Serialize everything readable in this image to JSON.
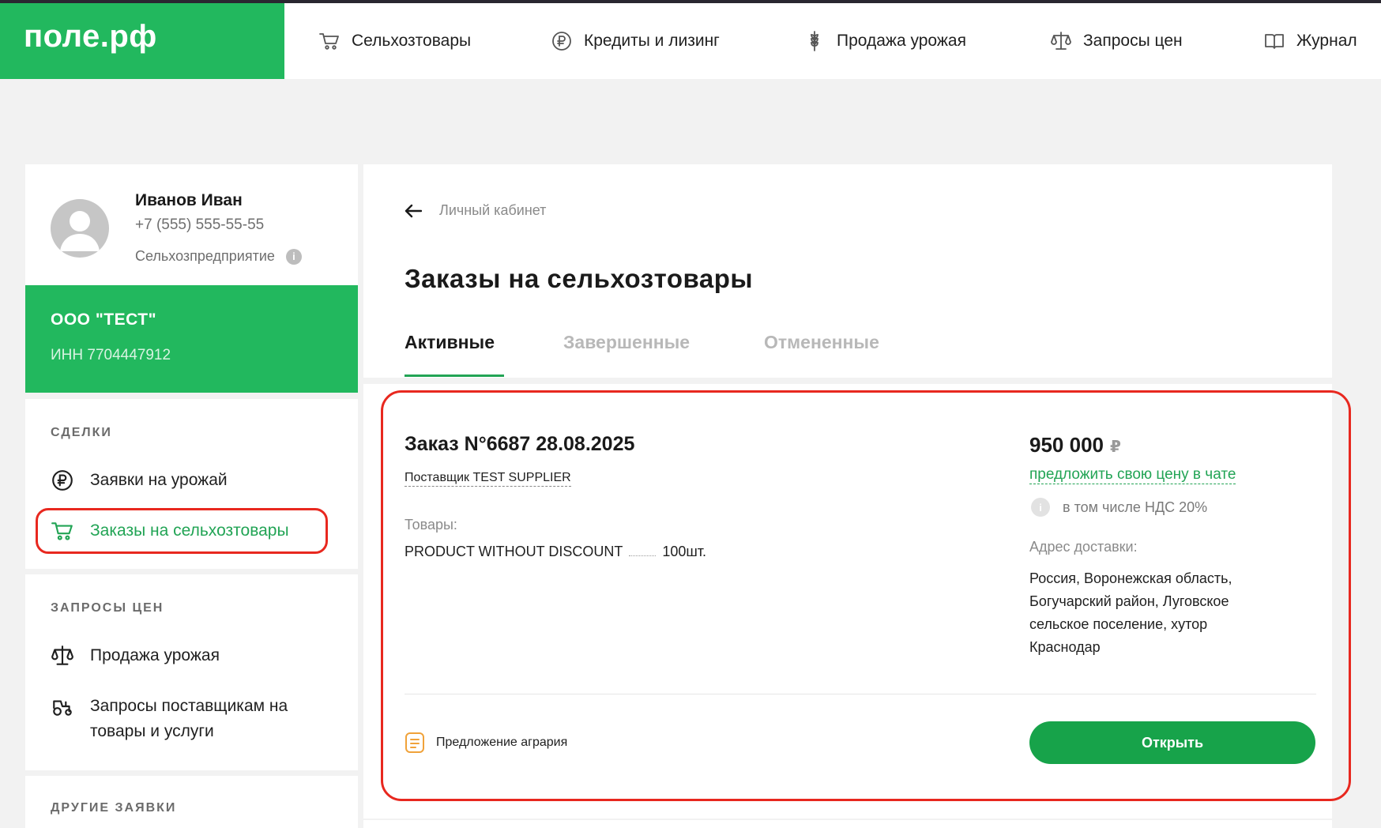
{
  "header": {
    "logo": "поле.рф",
    "nav": [
      {
        "label": "Сельхозтовары",
        "icon": "cart-icon"
      },
      {
        "label": "Кредиты и лизинг",
        "icon": "ruble-coin-icon"
      },
      {
        "label": "Продажа урожая",
        "icon": "wheat-icon"
      },
      {
        "label": "Запросы цен",
        "icon": "scales-icon"
      },
      {
        "label": "Журнал",
        "icon": "book-icon"
      }
    ]
  },
  "profile": {
    "name": "Иванов Иван",
    "phone": "+7 (555) 555-55-55",
    "type": "Сельхозпредприятие",
    "company": "ООО \"ТЕСТ\"",
    "inn": "ИНН 7704447912"
  },
  "sidebar": {
    "deals": {
      "label": "СДЕЛКИ",
      "items": [
        {
          "label": "Заявки на урожай",
          "icon": "ruble-coin-icon"
        },
        {
          "label": "Заказы на сельхозтовары",
          "icon": "cart-icon",
          "active": true
        }
      ]
    },
    "price_requests": {
      "label": "ЗАПРОСЫ ЦЕН",
      "items": [
        {
          "label": "Продажа урожая",
          "icon": "scales-icon"
        },
        {
          "label": "Запросы поставщикам на товары и услуги",
          "icon": "tractor-icon"
        }
      ]
    },
    "other": {
      "label": "ДРУГИЕ ЗАЯВКИ"
    }
  },
  "main": {
    "back": "Личный кабинет",
    "title": "Заказы на сельхозтовары",
    "tabs": [
      {
        "label": "Активные",
        "active": true
      },
      {
        "label": "Завершенные"
      },
      {
        "label": "Отмененные"
      }
    ]
  },
  "order": {
    "title": "Заказ N°6687 28.08.2025",
    "supplier": "Поставщик TEST SUPPLIER",
    "goods_label": "Товары:",
    "product_name": "PRODUCT WITHOUT DISCOUNT",
    "product_qty": "100шт.",
    "price": "950 000",
    "currency": "₽",
    "offer_link": "предложить свою цену в чате",
    "vat": "в том числе НДС 20%",
    "address_label": "Адрес доставки:",
    "address": "Россия, Воронежская область, Богучарский район, Луговское сельское поселение, хутор Краснодар",
    "proposal": "Предложение агрария",
    "open_button": "Открыть"
  },
  "colors": {
    "brand_green": "#22b85e",
    "button_green": "#17a34a",
    "highlight_red": "#e8281f"
  }
}
